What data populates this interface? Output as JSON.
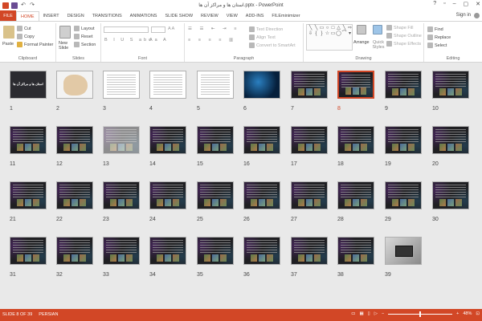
{
  "window": {
    "title": "استان ها و مراکز آن ها.pptx - PowerPoint",
    "signin": "Sign in",
    "controls": [
      "?",
      "▫",
      "–",
      "▢",
      "✕"
    ]
  },
  "tabs": [
    {
      "label": "FILE"
    },
    {
      "label": "HOME"
    },
    {
      "label": "INSERT"
    },
    {
      "label": "DESIGN"
    },
    {
      "label": "TRANSITIONS"
    },
    {
      "label": "ANIMATIONS"
    },
    {
      "label": "SLIDE SHOW"
    },
    {
      "label": "REVIEW"
    },
    {
      "label": "VIEW"
    },
    {
      "label": "ADD-INS"
    },
    {
      "label": "FILEminimizer"
    }
  ],
  "ribbon": {
    "clipboard": {
      "label": "Clipboard",
      "paste": "Paste",
      "cut": "Cut",
      "copy": "Copy",
      "format_painter": "Format Painter"
    },
    "slides": {
      "label": "Slides",
      "new_slide": "New Slide",
      "layout": "Layout",
      "reset": "Reset",
      "section": "Section"
    },
    "font": {
      "label": "Font"
    },
    "paragraph": {
      "label": "Paragraph",
      "text_direction": "Text Direction",
      "align_text": "Align Text",
      "convert": "Convert to SmartArt"
    },
    "drawing": {
      "label": "Drawing",
      "arrange": "Arrange",
      "quick_styles": "Quick Styles",
      "shape_fill": "Shape Fill",
      "shape_outline": "Shape Outline",
      "shape_effects": "Shape Effects"
    },
    "editing": {
      "label": "Editing",
      "find": "Find",
      "replace": "Replace",
      "select": "Select"
    }
  },
  "slide1_title": "استان ها و مراکز آن ها",
  "slides": [
    {
      "num": "1",
      "kind": "title1"
    },
    {
      "num": "2",
      "kind": "map"
    },
    {
      "num": "3",
      "kind": "white"
    },
    {
      "num": "4",
      "kind": "white"
    },
    {
      "num": "5",
      "kind": "white"
    },
    {
      "num": "6",
      "kind": "blue"
    },
    {
      "num": "7",
      "kind": "dark"
    },
    {
      "num": "8",
      "kind": "dark",
      "selected": true
    },
    {
      "num": "9",
      "kind": "dark"
    },
    {
      "num": "10",
      "kind": "dark"
    },
    {
      "num": "11",
      "kind": "dark"
    },
    {
      "num": "12",
      "kind": "dark"
    },
    {
      "num": "13",
      "kind": "dark",
      "faded": true
    },
    {
      "num": "14",
      "kind": "dark"
    },
    {
      "num": "15",
      "kind": "dark"
    },
    {
      "num": "16",
      "kind": "dark"
    },
    {
      "num": "17",
      "kind": "dark"
    },
    {
      "num": "18",
      "kind": "dark"
    },
    {
      "num": "19",
      "kind": "dark"
    },
    {
      "num": "20",
      "kind": "dark"
    },
    {
      "num": "21",
      "kind": "dark"
    },
    {
      "num": "22",
      "kind": "dark"
    },
    {
      "num": "23",
      "kind": "dark"
    },
    {
      "num": "24",
      "kind": "dark"
    },
    {
      "num": "25",
      "kind": "dark"
    },
    {
      "num": "26",
      "kind": "dark"
    },
    {
      "num": "27",
      "kind": "dark"
    },
    {
      "num": "28",
      "kind": "dark"
    },
    {
      "num": "29",
      "kind": "dark"
    },
    {
      "num": "30",
      "kind": "dark"
    },
    {
      "num": "31",
      "kind": "dark"
    },
    {
      "num": "32",
      "kind": "dark"
    },
    {
      "num": "33",
      "kind": "dark"
    },
    {
      "num": "34",
      "kind": "dark"
    },
    {
      "num": "35",
      "kind": "dark"
    },
    {
      "num": "36",
      "kind": "dark"
    },
    {
      "num": "37",
      "kind": "dark"
    },
    {
      "num": "38",
      "kind": "dark"
    },
    {
      "num": "39",
      "kind": "photo"
    }
  ],
  "status": {
    "slide_info": "SLIDE 8 OF 39",
    "language": "PERSIAN",
    "zoom": "48%",
    "zoom_fraction": 0.48
  },
  "colors": {
    "accent": "#d24726"
  }
}
